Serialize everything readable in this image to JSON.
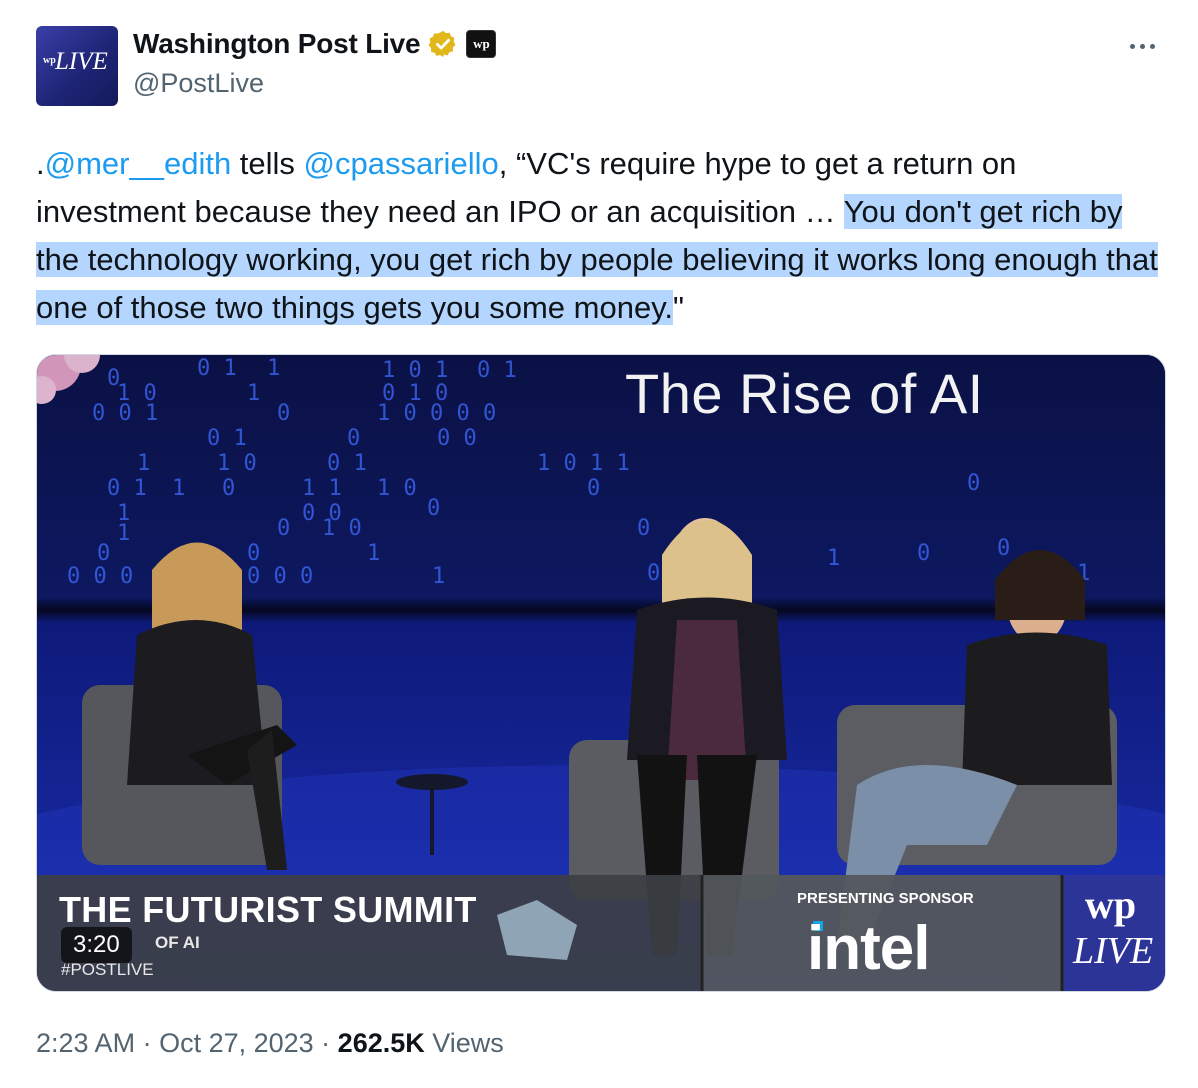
{
  "author": {
    "display_name": "Washington Post Live",
    "handle": "@PostLive",
    "avatar_text": "LIVE",
    "avatar_mark": "wp",
    "affiliate_badge": "wp"
  },
  "tweet": {
    "prefix": ".",
    "mention1": "@mer__edith",
    "text1": " tells ",
    "mention2": "@cpassariello",
    "text2": ", “VC's require hype to get a return on investment because they need an IPO or an acquisition … ",
    "highlighted": "You don't get rich by the technology working, you get rich by people believing it works long enough that one of those two things gets you some money.",
    "suffix": "\""
  },
  "video": {
    "screen_title": "The Rise of AI",
    "summit_title": "THE FUTURIST SUMMIT",
    "summit_subtitle": "OF AI",
    "hashtag": "#POSTLIVE",
    "timestamp": "3:20",
    "sponsor_label": "PRESENTING SPONSOR",
    "sponsor_name": "intel",
    "brand_wp": "wp",
    "brand_live": "LIVE"
  },
  "meta": {
    "time": "2:23 AM",
    "separator": " · ",
    "date": "Oct 27, 2023",
    "views_count": "262.5K",
    "views_label": " Views"
  },
  "colors": {
    "link": "#1d9bf0",
    "highlight": "#b4d5fe",
    "verified": "#e2b719",
    "secondary_text": "#536471"
  }
}
